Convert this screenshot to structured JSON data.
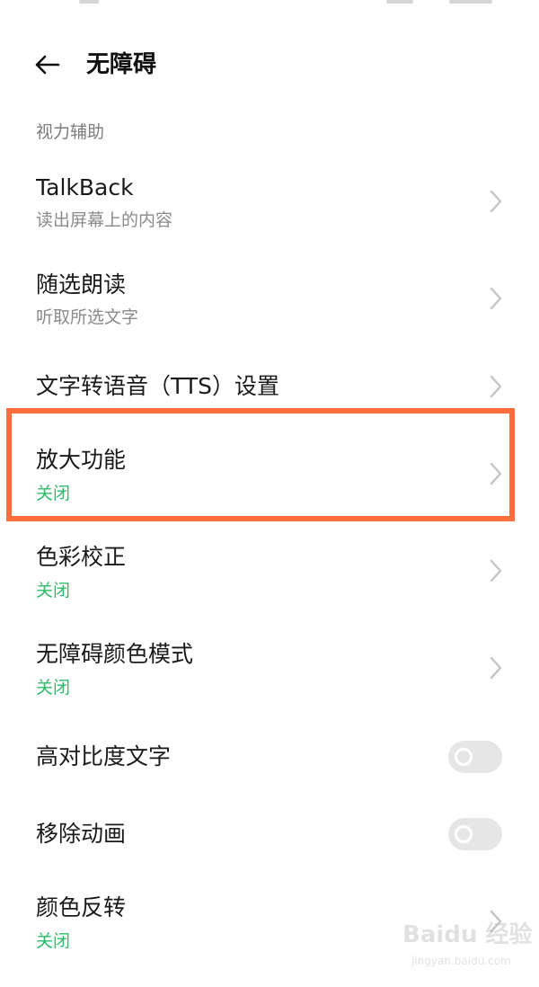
{
  "header": {
    "title": "无障碍"
  },
  "section": {
    "label": "视力辅助"
  },
  "items": [
    {
      "title": "TalkBack",
      "subtitle": "读出屏幕上的内容"
    },
    {
      "title": "随选朗读",
      "subtitle": "听取所选文字"
    },
    {
      "title": "文字转语音（TTS）设置"
    },
    {
      "title": "放大功能",
      "status": "关闭"
    },
    {
      "title": "色彩校正",
      "status": "关闭"
    },
    {
      "title": "无障碍颜色模式",
      "status": "关闭"
    },
    {
      "title": "高对比度文字",
      "toggle": "off"
    },
    {
      "title": "移除动画",
      "toggle": "off"
    },
    {
      "title": "颜色反转",
      "status": "关闭"
    }
  ],
  "watermark": {
    "text": "Baidu 经验",
    "sub": "jingyan.baidu.com"
  },
  "colors": {
    "status_green": "#2dbb6a",
    "highlight_orange": "#fb6f3c"
  },
  "icons": {
    "back": "arrow-left-icon",
    "chevron": "chevron-right-icon"
  }
}
